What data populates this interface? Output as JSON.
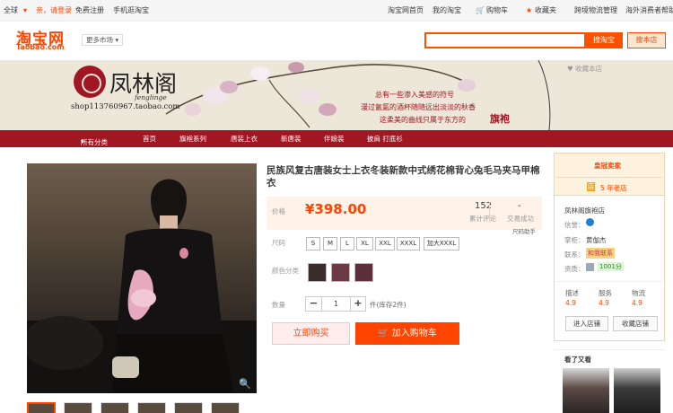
{
  "topbar": {
    "country": "全球",
    "greeting": "亲，请登录",
    "register": "免费注册",
    "mobile": "手机逛淘宝",
    "home": "淘宝网首页",
    "my": "我的淘宝",
    "cart": "购物车",
    "fav": "收藏夹",
    "crossborder": "跨境物流管理",
    "overseas": "海外消费者帮助"
  },
  "header": {
    "logo_cn": "淘宝网",
    "logo_en": "Taobao.com",
    "more_markets": "更多市场",
    "search_btn": "搜淘宝",
    "search_store_btn": "搜本店"
  },
  "banner": {
    "shop_name": "凤林阁",
    "shop_name_en": "fenglinge",
    "shop_url": "shop113760967.taobao.com",
    "line1": "总有一些渗入美感的符号",
    "line2": "漫过氤氲的酒杯随随远出淡淡的秋香",
    "line3a": "这柔美的曲线只属于东方的",
    "line3b": "旗袍",
    "fav_store": "收藏本店"
  },
  "nav": [
    "所有分类",
    "首页",
    "旗袍系列",
    "唐装上衣",
    "新唐装",
    "伴娘装",
    "披肩 打底衫"
  ],
  "product": {
    "title": "民族风复古唐装女士上衣冬装新款中式绣花棉背心兔毛马夹马甲棉衣",
    "price_label": "价格",
    "price": "¥398.00",
    "reviews_count": "152",
    "reviews_label": "累计评论",
    "sales_count": "-",
    "sales_label": "交易成功",
    "size_label": "尺码",
    "sizes": [
      "S",
      "M",
      "L",
      "XL",
      "XXL",
      "XXXL",
      "加大XXXL"
    ],
    "color_label": "颜色分类",
    "qty_label": "数量",
    "qty": "1",
    "stock": "件(库存2件)",
    "buy_now": "立即购买",
    "add_cart": "加入购物车",
    "size_guide": "尺码助手"
  },
  "seller": {
    "badge": "皇冠卖家",
    "years": "5 年老店",
    "shop": "凤林阁旗袍店",
    "credit_label": "信誉：",
    "keeper_label": "掌柜：",
    "keeper": "黄伽杰",
    "contact_label": "联系：",
    "contact_btn": "和我联系",
    "qual_label": "资质：",
    "qual_score": "1001分",
    "desc_label": "描述",
    "desc": "4.9",
    "service_label": "服务",
    "service": "4.9",
    "ship_label": "物流",
    "ship": "4.9",
    "enter_btn": "进入店铺",
    "fav_btn": "收藏店铺",
    "seen_title": "看了又看"
  },
  "colors": {
    "accent": "#ff4400",
    "banner_nav": "#a01622"
  }
}
